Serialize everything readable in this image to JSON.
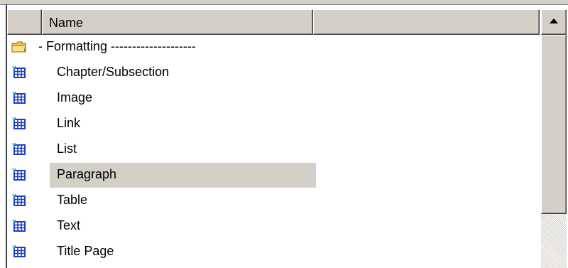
{
  "columns": [
    {
      "label": ""
    },
    {
      "label": "Name"
    },
    {
      "label": ""
    }
  ],
  "rows": [
    {
      "label": "- Formatting --------------------",
      "icon": "folder-icon",
      "selected": false,
      "type": "folder"
    },
    {
      "label": "Chapter/Subsection",
      "icon": "table-icon",
      "selected": false,
      "type": "item"
    },
    {
      "label": "Image",
      "icon": "table-icon",
      "selected": false,
      "type": "item"
    },
    {
      "label": "Link",
      "icon": "table-icon",
      "selected": false,
      "type": "item"
    },
    {
      "label": "List",
      "icon": "table-icon",
      "selected": false,
      "type": "item"
    },
    {
      "label": "Paragraph",
      "icon": "table-icon",
      "selected": true,
      "type": "item"
    },
    {
      "label": "Table",
      "icon": "table-icon",
      "selected": false,
      "type": "item"
    },
    {
      "label": "Text",
      "icon": "table-icon",
      "selected": false,
      "type": "item"
    },
    {
      "label": "Title Page",
      "icon": "table-icon",
      "selected": false,
      "type": "item"
    }
  ],
  "colors": {
    "selection": "#d4d0c8",
    "folder": "#f2c94c",
    "grid_icon": "#1f3fbf",
    "grid_icon_accent": "#18a0c8"
  }
}
